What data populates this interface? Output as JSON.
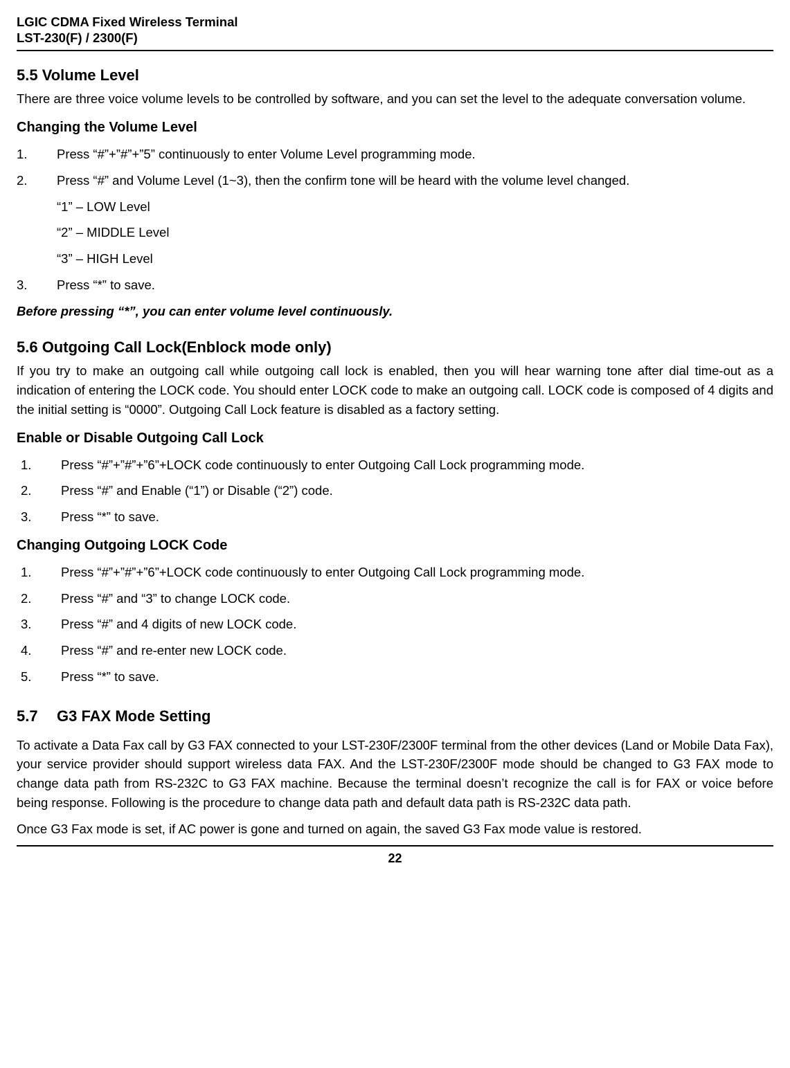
{
  "header": {
    "line1": "LGIC CDMA Fixed Wireless Terminal",
    "line2": "LST-230(F) / 2300(F)"
  },
  "sec55": {
    "title": "5.5  Volume Level",
    "intro": "There are three voice volume levels to be controlled by software, and you can set the level to the adequate conversation volume.",
    "sub": "Changing the Volume Level",
    "items": [
      "Press “#”+”#”+”5” continuously to enter Volume Level programming mode.",
      "Press “#” and Volume Level (1~3), then the confirm tone will be heard with the volume level changed."
    ],
    "levels": [
      "“1” – LOW Level",
      "“2” – MIDDLE Level",
      "“3” – HIGH Level"
    ],
    "item3": "Press “*” to save.",
    "note": "Before pressing “*”, you can enter volume level continuously."
  },
  "sec56": {
    "title": "5.6  Outgoing Call Lock(Enblock mode only)",
    "intro": "If you try to make an outgoing call while outgoing call lock is enabled, then you will hear warning tone after dial time-out as a indication of entering the LOCK code. You should enter LOCK code to make an outgoing call. LOCK code is composed of 4 digits and the initial setting is “0000”. Outgoing Call Lock feature is disabled as a factory setting.",
    "subA": "Enable or Disable Outgoing Call Lock",
    "listA": [
      "Press “#”+”#”+”6”+LOCK code continuously to enter Outgoing Call Lock programming  mode.",
      "Press “#” and Enable (“1”) or Disable (“2”) code.",
      "Press “*” to save."
    ],
    "subB": "Changing Outgoing LOCK Code",
    "listB": [
      "Press “#”+”#”+”6”+LOCK code continuously to enter Outgoing Call Lock programming mode.",
      "Press “#” and “3” to change LOCK code.",
      "Press “#” and 4 digits of new LOCK code.",
      "Press “#” and re-enter new LOCK code.",
      "Press “*” to save."
    ]
  },
  "sec57": {
    "num": "5.7",
    "title": "G3 FAX Mode Setting",
    "p1": "To activate a Data Fax call by G3 FAX connected to your LST-230F/2300F terminal from the other devices (Land or Mobile Data Fax), your service provider should support wireless data FAX. And the LST-230F/2300F mode should be changed to G3 FAX mode to change data path from RS-232C to G3 FAX machine. Because the terminal doesn’t recognize the call is for FAX or voice before being response. Following is the procedure to change data path and default data path is RS-232C data path.",
    "p2": "Once G3 Fax mode is set, if AC power is gone and turned on again, the saved G3 Fax mode value is restored."
  },
  "page": "22"
}
